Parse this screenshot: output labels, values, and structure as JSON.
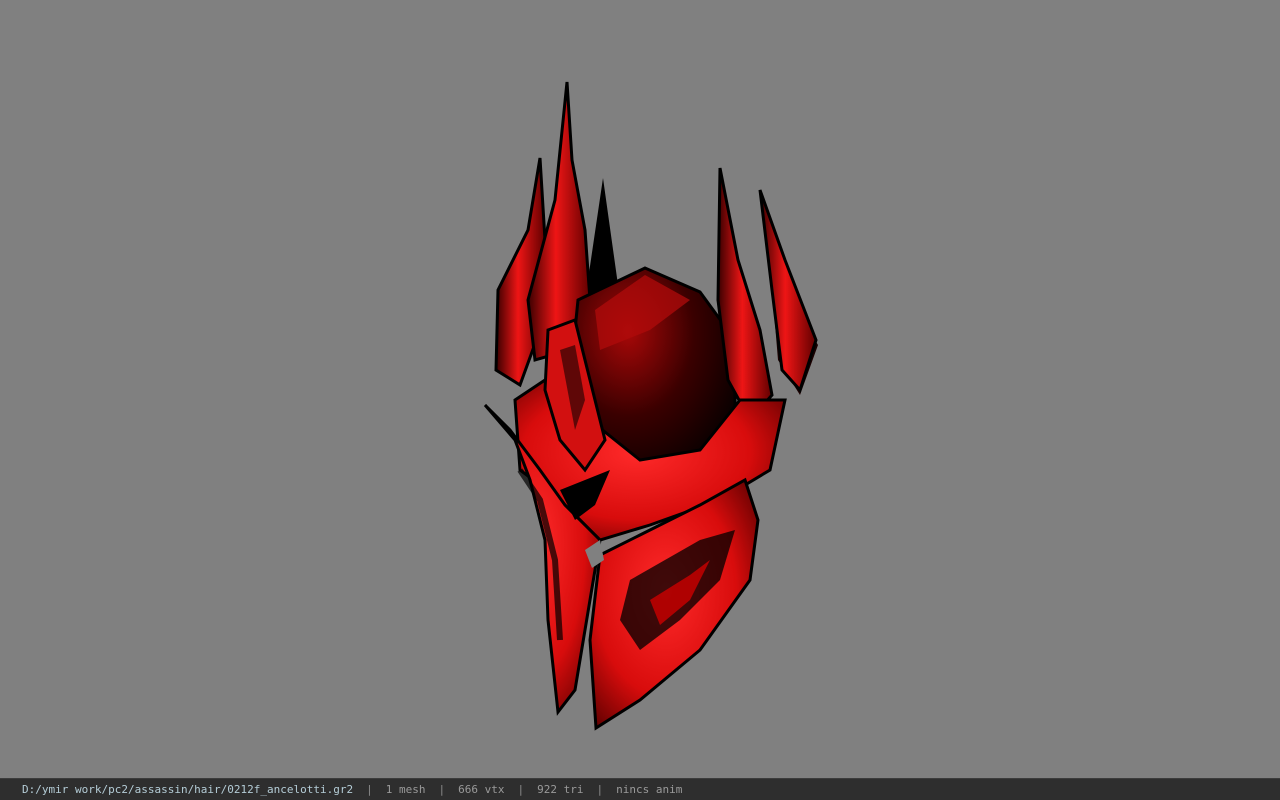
{
  "viewer": {
    "background_color": "#808080",
    "model_colors": {
      "primary": "#e01010",
      "highlight": "#ff2a2a",
      "shadow": "#000000",
      "mid": "#8a0000"
    }
  },
  "status_bar": {
    "file_path": "D:/ymir work/pc2/assassin/hair/0212f_ancelotti.gr2",
    "separator": "|",
    "mesh_count": "1 mesh",
    "vertex_count": "666 vtx",
    "triangle_count": "922 tri",
    "animation": "nincs anim"
  }
}
